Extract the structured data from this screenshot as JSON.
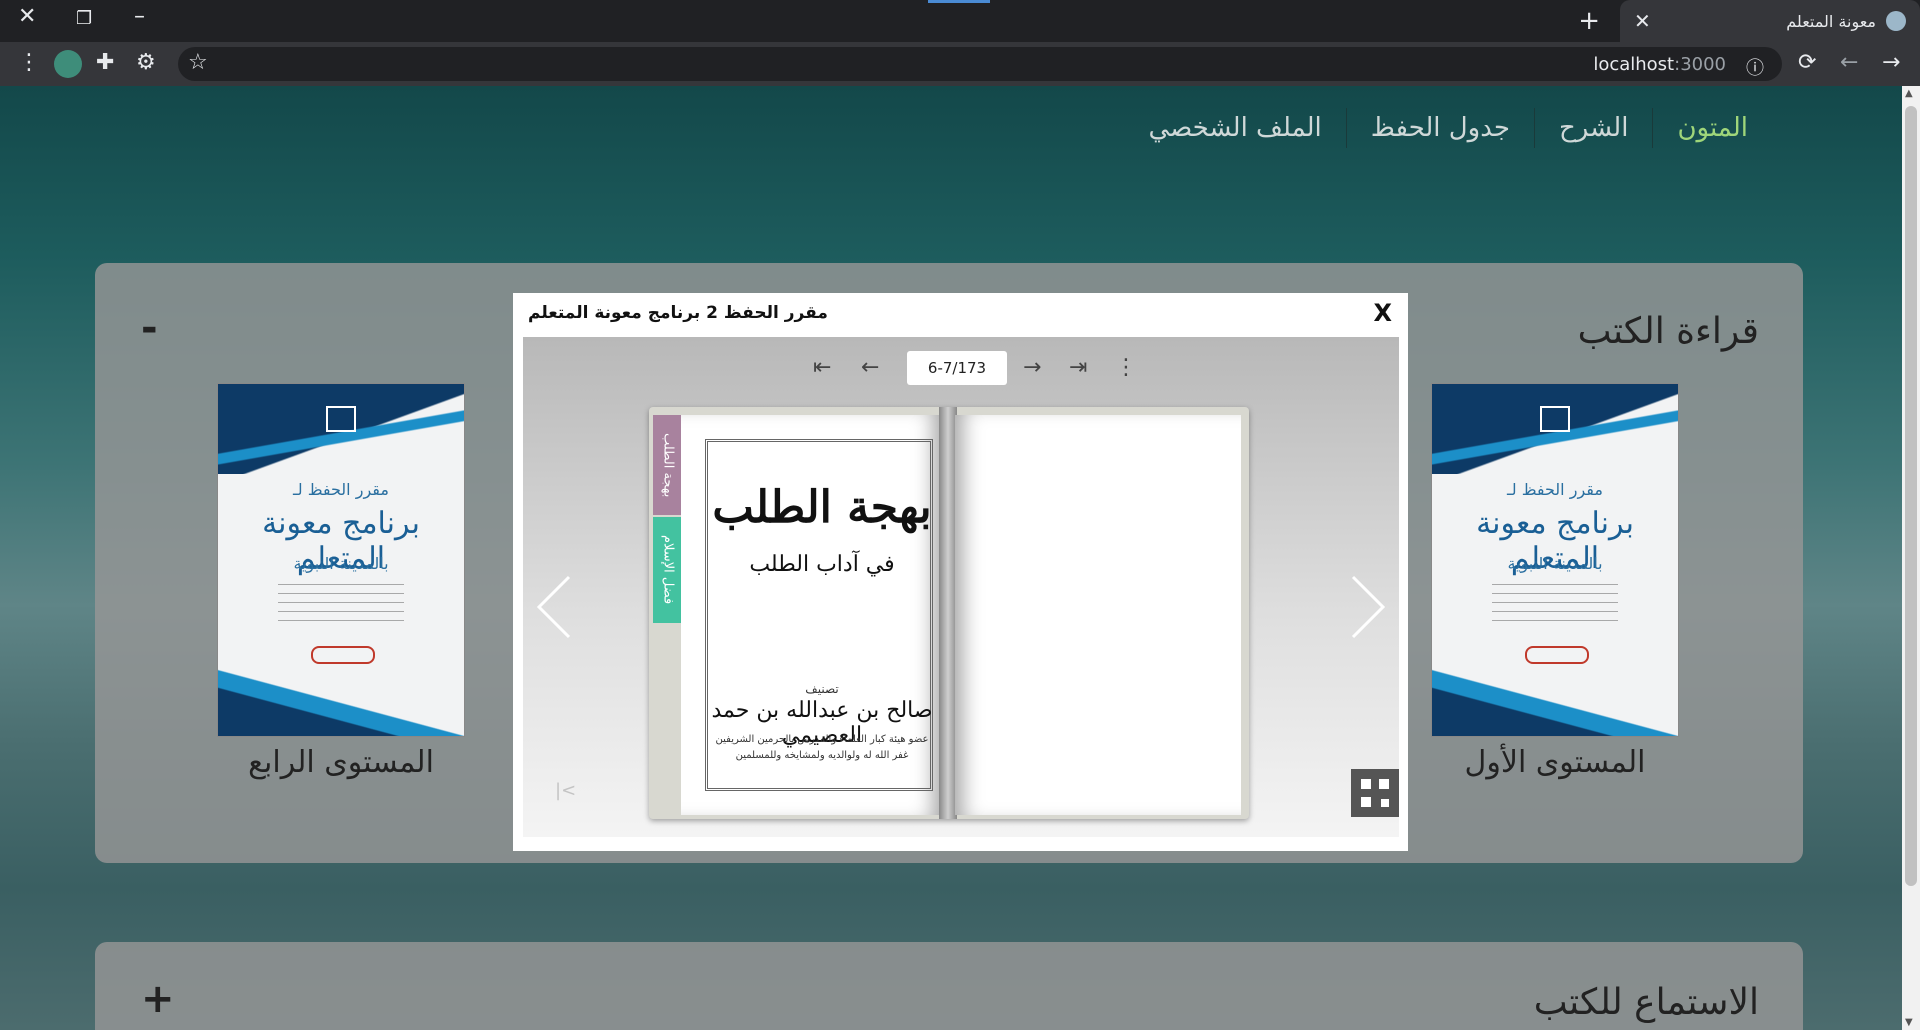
{
  "browser": {
    "tab_title": "معونة المتعلم",
    "new_tab": "+",
    "tab_close": "✕",
    "url_host": "localhost",
    "url_port": ":3000"
  },
  "nav": {
    "items": [
      "المتون",
      "الشرح",
      "جدول الحفظ",
      "الملف الشخصي"
    ],
    "active_color": "#9fd67a"
  },
  "reading": {
    "title": "قراءة الكتب",
    "toggle": "-",
    "books": [
      {
        "label": "المستوى الأول",
        "badge": "المستوى الأول"
      },
      {
        "label": "المستوى الرابع",
        "badge": "المستوى الرابع"
      }
    ],
    "cover": {
      "line1": "مقرر الحفظ لـ",
      "line2": "برنامج معونة المتعلم",
      "line3": "بالمدينة النبوية"
    }
  },
  "listening": {
    "title": "الاستماع للكتب",
    "toggle": "+"
  },
  "modal": {
    "title": "مقرر الحفظ 2 برنامج معونة المتعلم",
    "close": "X",
    "page_indicator": "6-7/173",
    "tabs": [
      "بهجة الطلب",
      "فضل الإسلام"
    ],
    "book_page": {
      "title": "بهجة الطلب",
      "subtitle": "في آداب الطلب",
      "author_prefix": "تصنيف",
      "author": "صالح بن عبدالله بن حمد العصيمي",
      "author_lines": [
        "عضو هيئة كبار العلماء والمدرس بالحرمين الشريفين",
        "غفر الله له ولوالديه ولمشايخه وللمسلمين"
      ]
    }
  }
}
